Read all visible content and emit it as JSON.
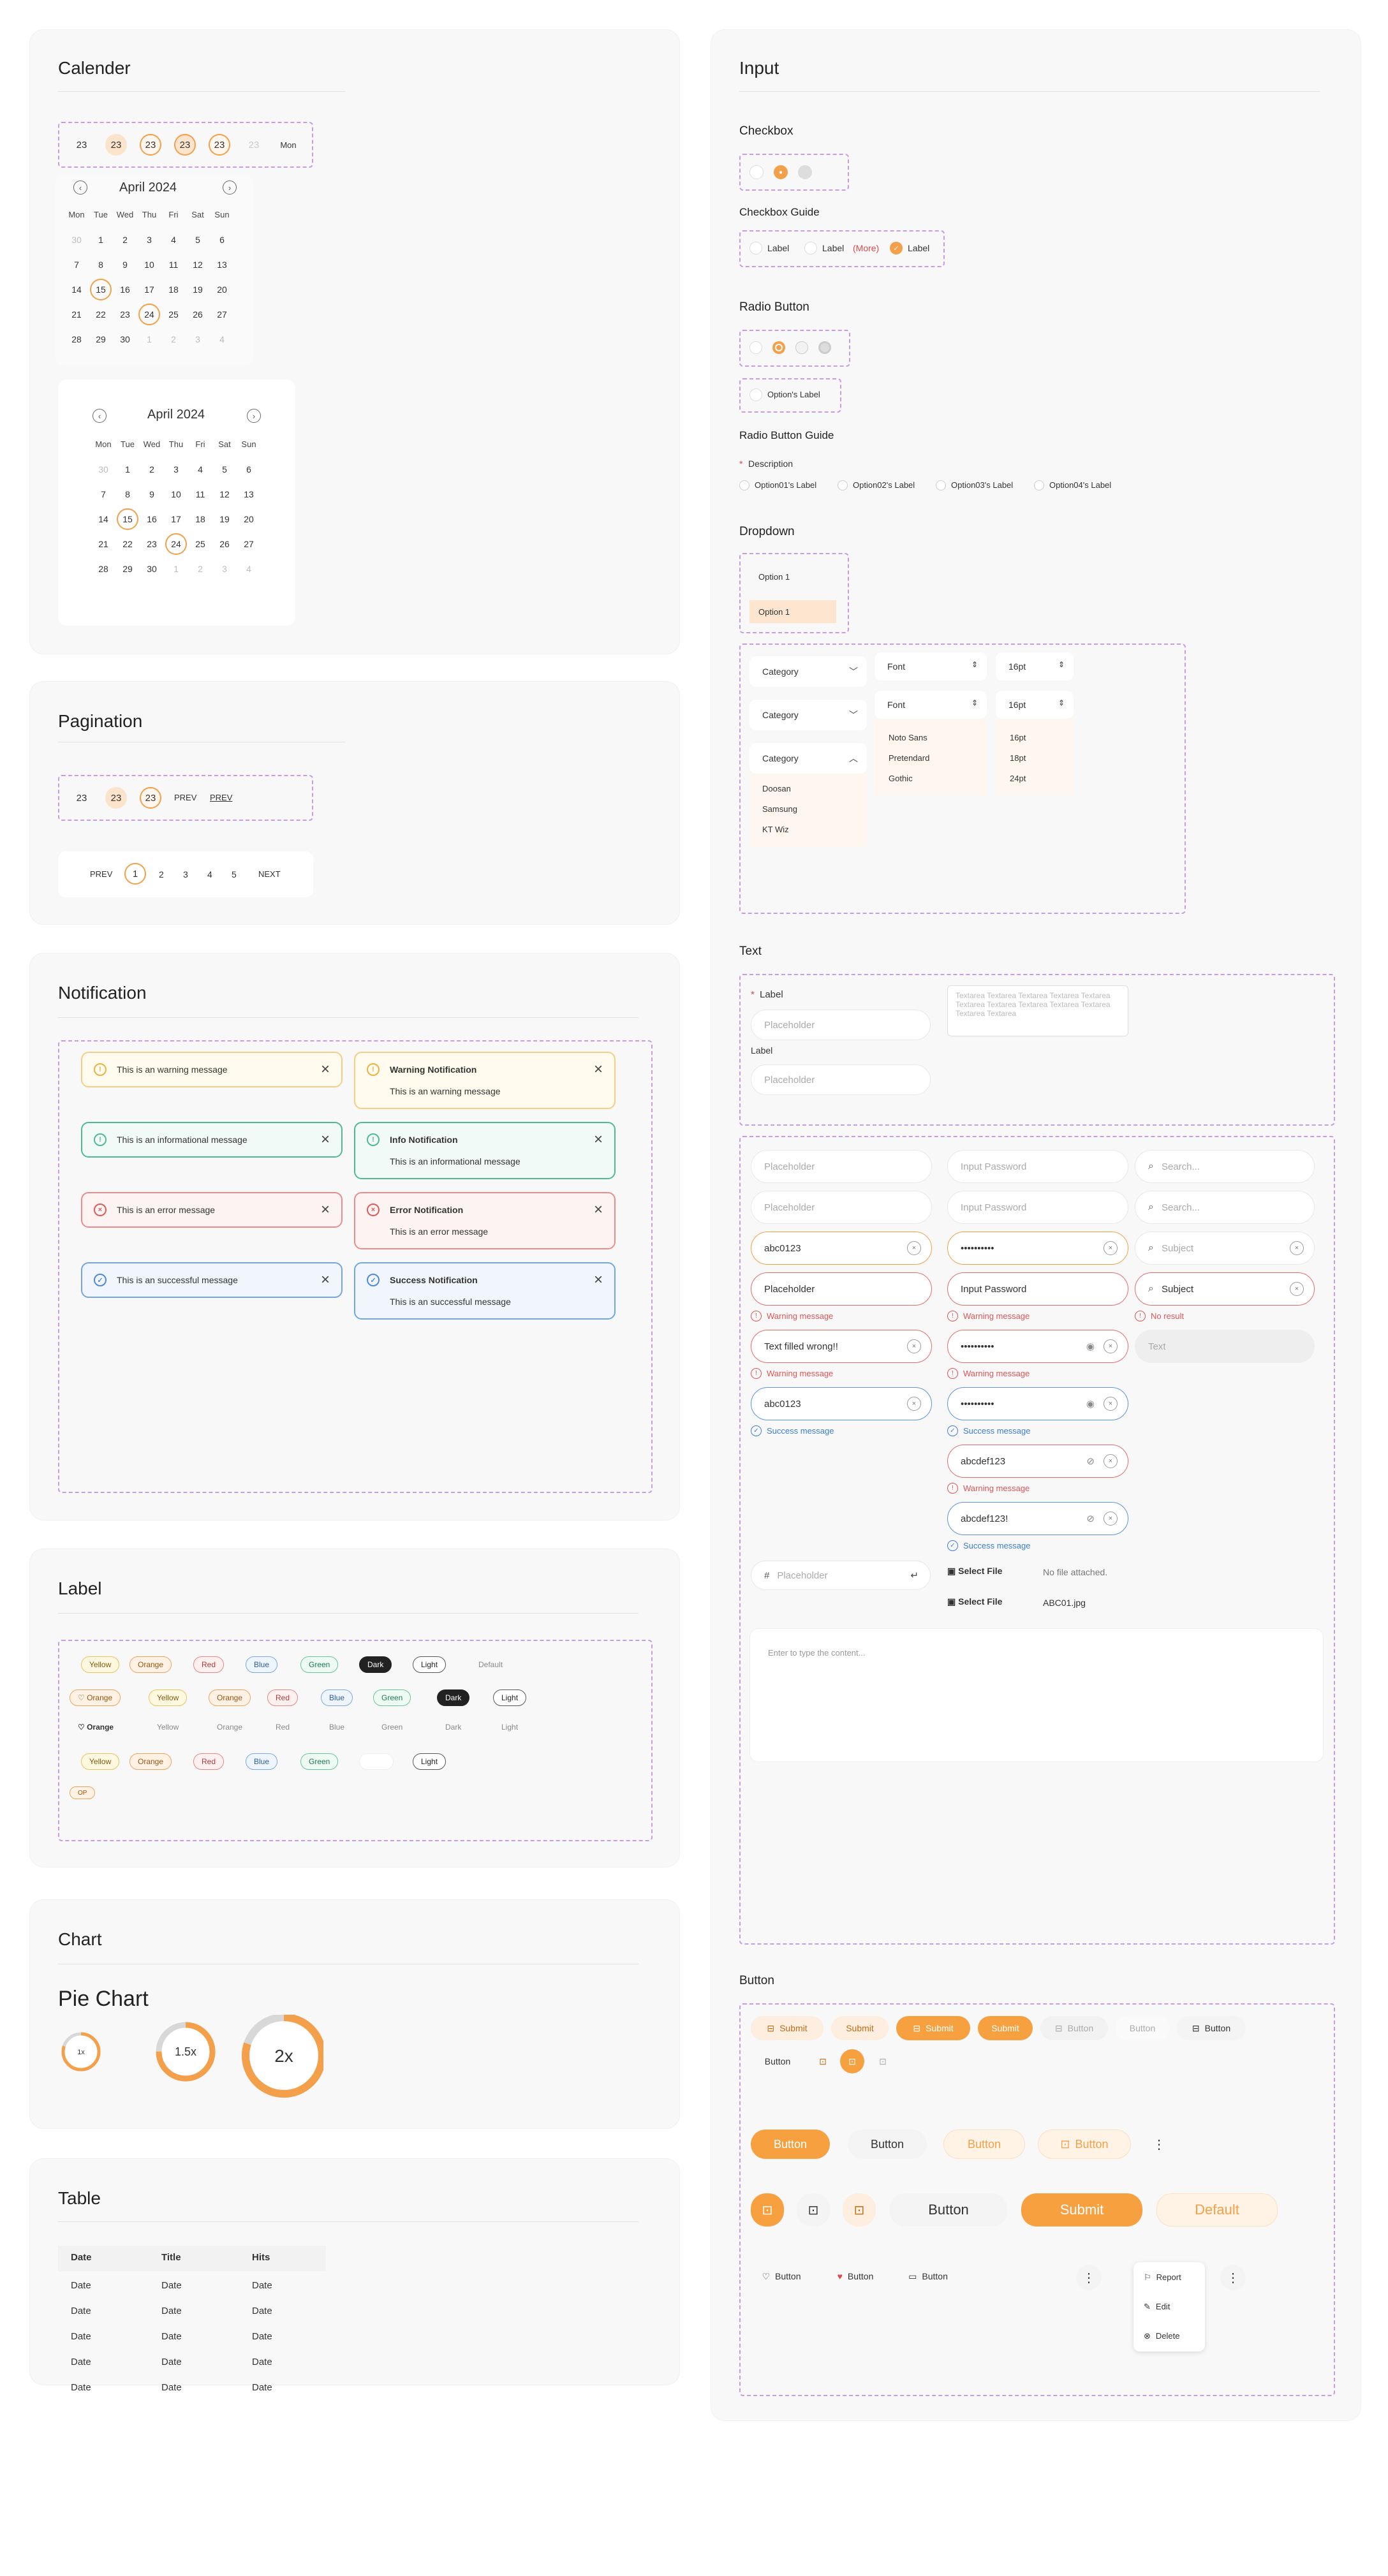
{
  "calendar": {
    "title": "Calender",
    "strip": [
      "23",
      "23",
      "23",
      "23",
      "23",
      "23",
      "Mon"
    ],
    "month": "April 2024",
    "weekdays": [
      "Mon",
      "Tue",
      "Wed",
      "Thu",
      "Fri",
      "Sat",
      "Sun"
    ],
    "days1": [
      "30",
      "1",
      "2",
      "3",
      "4",
      "5",
      "6",
      "7",
      "8",
      "9",
      "10",
      "11",
      "12",
      "13",
      "14",
      "15",
      "16",
      "17",
      "18",
      "19",
      "20",
      "21",
      "22",
      "23",
      "24",
      "25",
      "26",
      "27",
      "28",
      "29",
      "30",
      "1",
      "2",
      "3",
      "4"
    ],
    "prev": "‹",
    "next": "›"
  },
  "pagination": {
    "title": "Pagination",
    "strip": [
      "23",
      "23",
      "23",
      "PREV",
      "PREV"
    ],
    "pages": [
      "PREV",
      "1",
      "2",
      "3",
      "4",
      "5",
      "NEXT"
    ]
  },
  "notification": {
    "title": "Notification",
    "short": [
      "This is an warning message",
      "This is an informational message",
      "This is an error message",
      "This is an successful message"
    ],
    "long": [
      {
        "t": "Warning Notification",
        "m": "This is an warning message"
      },
      {
        "t": "Info Notification",
        "m": "This is an informational message"
      },
      {
        "t": "Error Notification",
        "m": "This is an error message"
      },
      {
        "t": "Success Notification",
        "m": "This is an successful message"
      }
    ]
  },
  "label": {
    "title": "Label",
    "row1": [
      "Yellow",
      "Orange",
      "Red",
      "Blue",
      "Green",
      "Dark",
      "Light",
      "Default"
    ],
    "row2": [
      "♡ Orange",
      "Yellow",
      "Orange",
      "Red",
      "Blue",
      "Green",
      "Dark",
      "Light"
    ],
    "row3": [
      "♡ Orange",
      "Yellow",
      "Orange",
      "Red",
      "Blue",
      "Green",
      "Dark",
      "Light"
    ],
    "row4": [
      "Yellow",
      "Orange",
      "Red",
      "Blue",
      "Green",
      "",
      "Light"
    ],
    "row5": [
      "OP"
    ]
  },
  "chart": {
    "title": "Chart",
    "subtitle": "Pie Chart"
  },
  "chart_data": {
    "type": "pie",
    "title": "Pie Chart",
    "labels": [
      "1x",
      "1.5x",
      "2x"
    ],
    "values": [
      0.8,
      0.75,
      0.8
    ]
  },
  "table": {
    "title": "Table",
    "headers": [
      "Date",
      "Title",
      "Hits"
    ],
    "cell": "Date",
    "rows": 4
  },
  "input": {
    "title": "Input",
    "checkbox": "Checkbox",
    "checkbox_guide": "Checkbox Guide",
    "cb_labels": [
      "Label",
      "Label",
      "(More)",
      "Label"
    ],
    "radio": "Radio Button",
    "radio_single": "Option's Label",
    "radio_guide": "Radio Button Guide",
    "radio_desc": "Description",
    "radio_opts": [
      "Option01's Label",
      "Option02's Label",
      "Option03's Label",
      "Option04's Label"
    ],
    "dropdown": "Dropdown",
    "dd_opt": "Option 1",
    "category": "Category",
    "font": "Font",
    "size": "16pt",
    "cat_list": [
      "Doosan",
      "Samsung",
      "KT Wiz"
    ],
    "font_list": [
      "Noto Sans",
      "Pretendard",
      "Gothic"
    ],
    "size_list": [
      "16pt",
      "18pt",
      "24pt"
    ],
    "text": "Text",
    "lbl": "Label",
    "placeholder": "Placeholder",
    "textarea": "Textarea Textarea Textarea Textarea Textarea Textarea Textarea Textarea Textarea Textarea Textarea Textarea",
    "pwd": "Input Password",
    "search": "Search...",
    "subject": "Subject",
    "abc": "abc0123",
    "dots": "••••••••••",
    "wrong": "Text filled wrong!!",
    "tval": "Text",
    "warn": "Warning message",
    "succ": "Success message",
    "nores": "No result",
    "abcdef": "abcdef123",
    "abcdef2": "abcdef123!",
    "hash": "#",
    "select_file": "Select File",
    "nofile": "No file attached.",
    "file": "ABC01.jpg",
    "content": "Enter to type the content..."
  },
  "button": {
    "title": "Button",
    "submit": "Submit",
    "button": "Button",
    "default": "Default",
    "report": "Report",
    "edit": "Edit",
    "delete": "Delete"
  }
}
